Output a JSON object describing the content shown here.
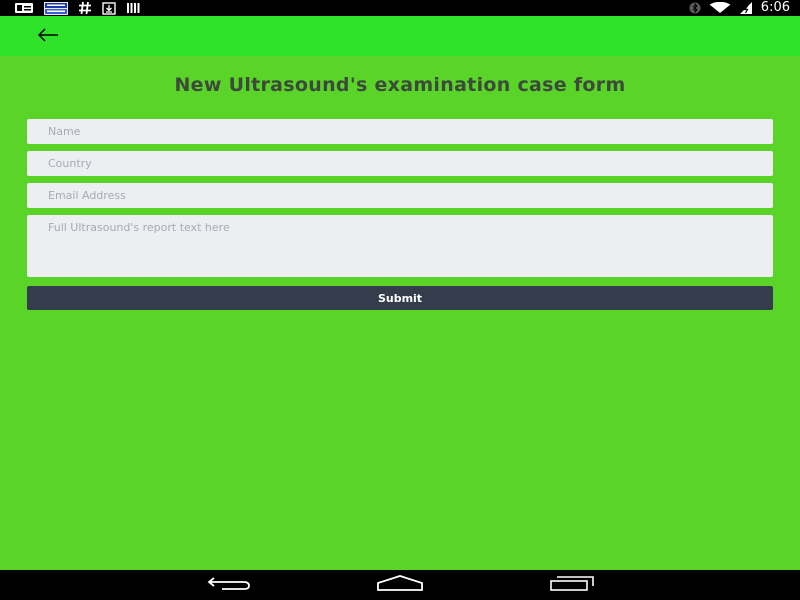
{
  "status_bar": {
    "time": "6:06",
    "left_icons": [
      "notification-card-icon",
      "news-app-icon",
      "hashtag-icon",
      "download-icon",
      "barcode-icon"
    ],
    "right_icons": [
      "bluetooth-icon",
      "wifi-icon",
      "battery-charging-icon"
    ]
  },
  "app_bar": {
    "color": "#2fe32a",
    "back_icon": "arrow-left-icon"
  },
  "form": {
    "title": "New Ultrasound's examination case form",
    "name_placeholder": "Name",
    "country_placeholder": "Country",
    "email_placeholder": "Email Address",
    "report_placeholder": "Full Ultrasound's report text here",
    "submit_label": "Submit"
  },
  "nav_bar": {
    "buttons": [
      "back-icon",
      "home-icon",
      "recents-icon"
    ]
  },
  "colors": {
    "background": "#5bd42a",
    "app_bar": "#2fe32a",
    "input_bg": "#eceef2",
    "button_bg": "#353d4d",
    "title_text": "#3c4a3a"
  }
}
